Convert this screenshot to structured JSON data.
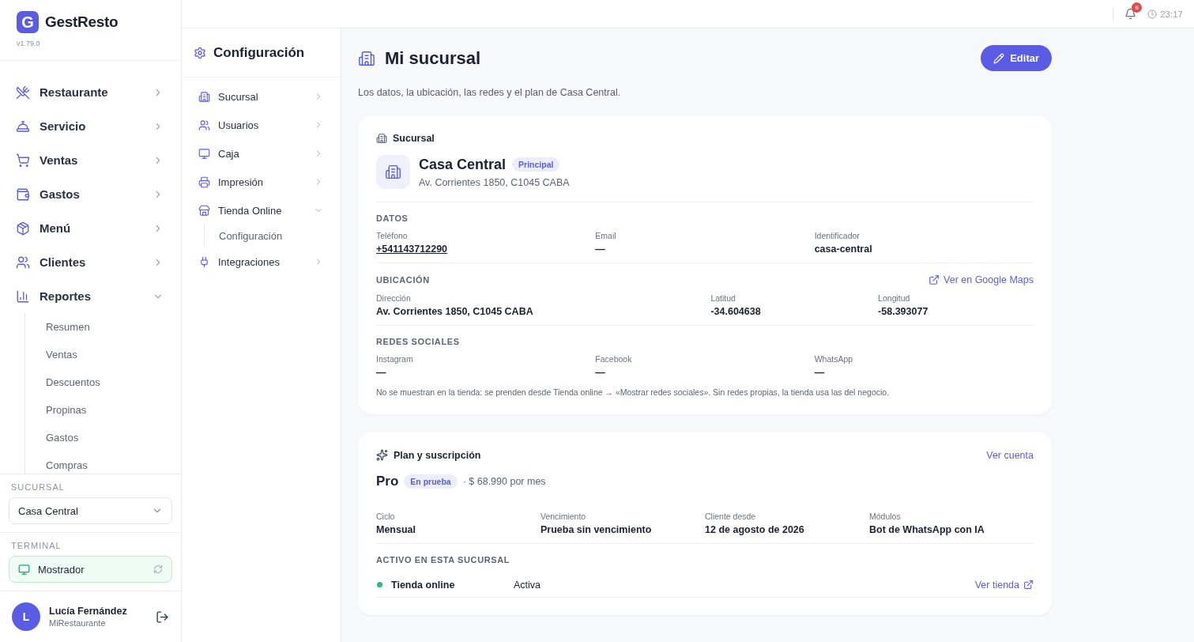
{
  "app": {
    "logo_letter": "G",
    "name": "GestResto",
    "version": "v1.79.0"
  },
  "sidebar": {
    "items": [
      {
        "label": "Restaurante",
        "expanded": false
      },
      {
        "label": "Servicio",
        "expanded": false
      },
      {
        "label": "Ventas",
        "expanded": false
      },
      {
        "label": "Gastos",
        "expanded": false
      },
      {
        "label": "Menú",
        "expanded": false
      },
      {
        "label": "Clientes",
        "expanded": false
      },
      {
        "label": "Reportes",
        "expanded": true,
        "children": [
          {
            "label": "Resumen"
          },
          {
            "label": "Ventas"
          },
          {
            "label": "Descuentos"
          },
          {
            "label": "Propinas"
          },
          {
            "label": "Gastos"
          },
          {
            "label": "Compras"
          }
        ]
      }
    ]
  },
  "branch_selector": {
    "label": "SUCURSAL",
    "value": "Casa Central"
  },
  "terminal": {
    "label": "TERMINAL",
    "value": "Mostrador"
  },
  "user": {
    "initial": "L",
    "name": "Lucía Fernández",
    "org": "MiRestaurante"
  },
  "topbar": {
    "notifications": "6",
    "time": "23:17"
  },
  "config_nav": {
    "title": "Configuración",
    "items": [
      {
        "label": "Sucursal",
        "expanded": false
      },
      {
        "label": "Usuarios",
        "expanded": false
      },
      {
        "label": "Caja",
        "expanded": false
      },
      {
        "label": "Impresión",
        "expanded": false
      },
      {
        "label": "Tienda Online",
        "expanded": true,
        "children": [
          {
            "label": "Configuración"
          }
        ]
      },
      {
        "label": "Integraciones",
        "expanded": false
      }
    ]
  },
  "page": {
    "title": "Mi sucursal",
    "subtitle": "Los datos, la ubicación, las redes y el plan de Casa Central.",
    "edit_button": "Editar"
  },
  "branch_card": {
    "title": "Sucursal",
    "name": "Casa Central",
    "badge": "Principal",
    "address": "Av. Corrientes 1850, C1045 CABA",
    "sections": [
      {
        "kind": "grid",
        "title": "DATOS",
        "fields": [
          {
            "label": "Teléfono",
            "value": "+541143712290",
            "kind": "link"
          },
          {
            "label": "Email",
            "value": "—",
            "kind": "text"
          },
          {
            "label": "Identificador",
            "value": "casa-central",
            "kind": "text"
          }
        ]
      },
      {
        "kind": "location",
        "title": "UBICACIÓN",
        "link": "Ver en Google Maps",
        "fields": [
          {
            "label": "Dirección",
            "value": "Av. Corrientes 1850, C1045 CABA",
            "kind": "text"
          },
          {
            "label": "Latitud",
            "value": "-34.604638",
            "kind": "text"
          },
          {
            "label": "Longitud",
            "value": "-58.393077",
            "kind": "text"
          }
        ]
      },
      {
        "kind": "grid",
        "title": "REDES SOCIALES",
        "fields": [
          {
            "label": "Instagram",
            "value": "—",
            "kind": "text"
          },
          {
            "label": "Facebook",
            "value": "—",
            "kind": "text"
          },
          {
            "label": "WhatsApp",
            "value": "—",
            "kind": "text"
          }
        ],
        "note": "No se muestran en la tienda: se prenden desde Tienda online → «Mostrar redes sociales». Sin redes propias, la tienda usa las del negocio."
      }
    ]
  },
  "plan_card": {
    "title": "Plan y suscripción",
    "link": "Ver cuenta",
    "plan": "Pro",
    "badge": "En prueba",
    "price": "· $ 68.990 por mes",
    "fields": [
      {
        "label": "Ciclo",
        "value": "Mensual"
      },
      {
        "label": "Vencimiento",
        "value": "Prueba sin vencimiento"
      },
      {
        "label": "Cliente desde",
        "value": "12 de agosto de 2026"
      },
      {
        "label": "Módulos",
        "value": "Bot de WhatsApp con IA"
      }
    ],
    "active_title": "ACTIVO EN ESTA SUCURSAL",
    "active_items": [
      {
        "name": "Tienda online",
        "status": "Activa",
        "color": "#22c07a",
        "link": "Ver tienda"
      }
    ]
  }
}
